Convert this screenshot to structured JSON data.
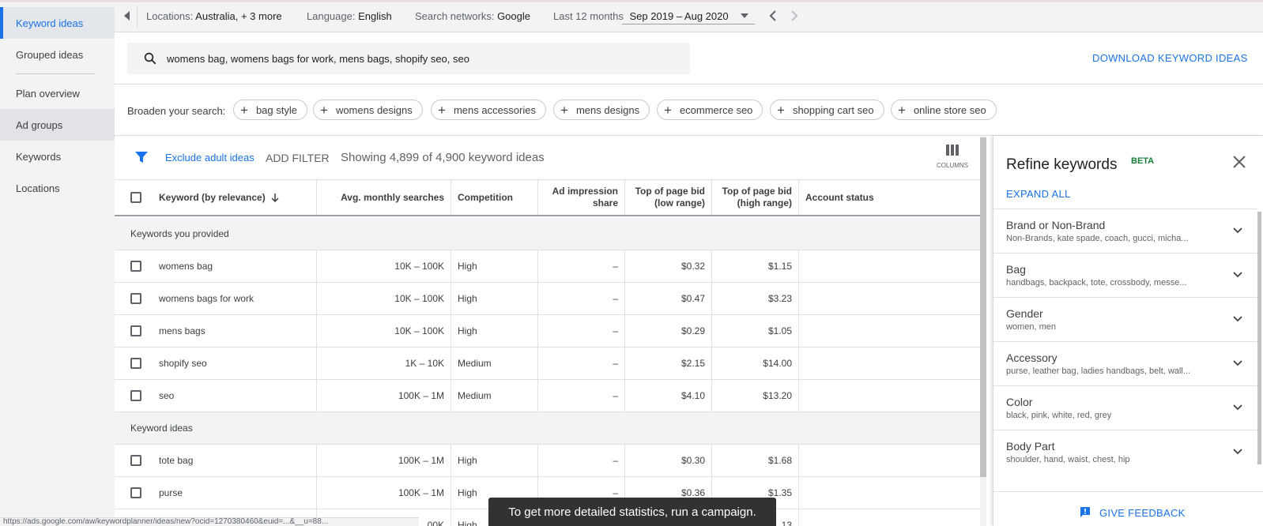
{
  "sidebar": {
    "items": [
      {
        "label": "Keyword ideas",
        "state": "active"
      },
      {
        "label": "Grouped ideas",
        "state": ""
      },
      {
        "label": "Plan overview",
        "state": ""
      },
      {
        "label": "Ad groups",
        "state": "hover"
      },
      {
        "label": "Keywords",
        "state": ""
      },
      {
        "label": "Locations",
        "state": ""
      }
    ]
  },
  "topbar": {
    "locations_label": "Locations:",
    "locations_value": "Australia, + 3 more",
    "language_label": "Language:",
    "language_value": "English",
    "networks_label": "Search networks:",
    "networks_value": "Google",
    "period_label": "Last 12 months",
    "period_value": "Sep 2019 – Aug 2020"
  },
  "search": {
    "query": "womens bag, womens bags for work, mens bags, shopify seo, seo"
  },
  "download_label": "DOWNLOAD KEYWORD IDEAS",
  "broaden": {
    "label": "Broaden your search:",
    "chips": [
      "bag style",
      "womens designs",
      "mens accessories",
      "mens designs",
      "ecommerce seo",
      "shopping cart seo",
      "online store seo"
    ]
  },
  "filters": {
    "exclude_adult": "Exclude adult ideas",
    "add_filter": "ADD FILTER",
    "showing": "Showing 4,899 of 4,900 keyword ideas",
    "columns_label": "COLUMNS"
  },
  "table": {
    "headers": {
      "keyword": "Keyword (by relevance)",
      "searches": "Avg. monthly searches",
      "competition": "Competition",
      "impression_1": "Ad impression",
      "impression_2": "share",
      "low_1": "Top of page bid",
      "low_2": "(low range)",
      "high_1": "Top of page bid",
      "high_2": "(high range)",
      "status": "Account status"
    },
    "group_provided": "Keywords you provided",
    "group_ideas": "Keyword ideas",
    "provided": [
      {
        "keyword": "womens bag",
        "searches": "10K – 100K",
        "competition": "High",
        "impression": "–",
        "low": "$0.32",
        "high": "$1.15"
      },
      {
        "keyword": "womens bags for work",
        "searches": "10K – 100K",
        "competition": "High",
        "impression": "–",
        "low": "$0.47",
        "high": "$3.23"
      },
      {
        "keyword": "mens bags",
        "searches": "10K – 100K",
        "competition": "High",
        "impression": "–",
        "low": "$0.29",
        "high": "$1.05"
      },
      {
        "keyword": "shopify seo",
        "searches": "1K – 10K",
        "competition": "Medium",
        "impression": "–",
        "low": "$2.15",
        "high": "$14.00"
      },
      {
        "keyword": "seo",
        "searches": "100K – 1M",
        "competition": "Medium",
        "impression": "–",
        "low": "$4.10",
        "high": "$13.20"
      }
    ],
    "ideas": [
      {
        "keyword": "tote bag",
        "searches": "100K – 1M",
        "competition": "High",
        "impression": "–",
        "low": "$0.30",
        "high": "$1.68"
      },
      {
        "keyword": "purse",
        "searches": "100K – 1M",
        "competition": "High",
        "impression": "–",
        "low": "$0.36",
        "high": "$1.35"
      },
      {
        "keyword": "",
        "searches": "00K",
        "competition": "High",
        "impression": "",
        "low": "",
        "high": "13"
      }
    ]
  },
  "refine": {
    "title": "Refine keywords",
    "beta": "BETA",
    "expand_all": "EXPAND ALL",
    "items": [
      {
        "title": "Brand or Non-Brand",
        "sub": "Non-Brands, kate spade, coach, gucci, micha..."
      },
      {
        "title": "Bag",
        "sub": "handbags, backpack, tote, crossbody, messe..."
      },
      {
        "title": "Gender",
        "sub": "women, men"
      },
      {
        "title": "Accessory",
        "sub": "purse, leather bag, ladies handbags, belt, wall..."
      },
      {
        "title": "Color",
        "sub": "black, pink, white, red, grey"
      },
      {
        "title": "Body Part",
        "sub": "shoulder, hand, waist, chest, hip"
      }
    ],
    "feedback": "GIVE FEEDBACK"
  },
  "toast": "To get more detailed statistics, run a campaign.",
  "status_url": "https://ads.google.com/aw/keywordplanner/ideas/new?ocid=1270380460&euid=...&__u=88..."
}
